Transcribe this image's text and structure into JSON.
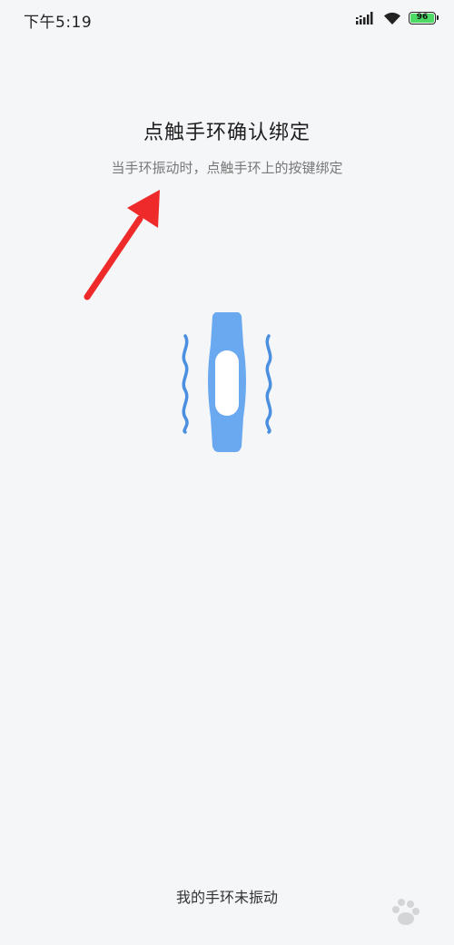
{
  "status_bar": {
    "time": "下午5:19",
    "battery_level": "96",
    "icons": [
      "signal-icon",
      "wifi-icon",
      "battery-icon"
    ]
  },
  "main": {
    "title": "点触手环确认绑定",
    "subtitle": "当手环振动时，点触手环上的按键绑定",
    "illustration": "vibrating-band-icon"
  },
  "footer": {
    "not_vibrating_link": "我的手环未振动"
  },
  "colors": {
    "background": "#f5f6f8",
    "band_blue": "#6aa9ef",
    "wave_blue": "#4a8fe0",
    "arrow_red": "#ee2a2a",
    "battery_green": "#4cd964"
  }
}
